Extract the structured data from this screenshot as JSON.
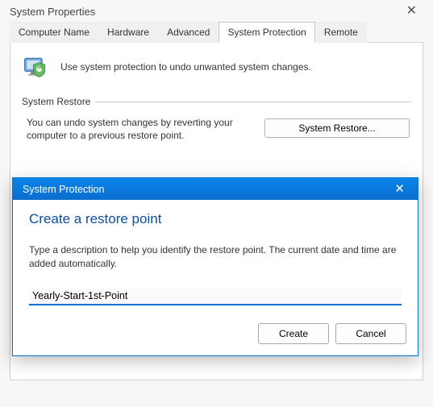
{
  "window": {
    "title": "System Properties"
  },
  "tabs": {
    "computer_name": "Computer Name",
    "hardware": "Hardware",
    "advanced": "Advanced",
    "system_protection": "System Protection",
    "remote": "Remote"
  },
  "protection": {
    "intro": "Use system protection to undo unwanted system changes."
  },
  "restore_section": {
    "header": "System Restore",
    "text": "You can undo system changes by reverting your computer to a previous restore point.",
    "button": "System Restore..."
  },
  "modal": {
    "title": "System Protection",
    "heading": "Create a restore point",
    "description": "Type a description to help you identify the restore point. The current date and time are added automatically.",
    "input_value": "Yearly-Start-1st-Point",
    "create_button": "Create",
    "cancel_button": "Cancel"
  }
}
